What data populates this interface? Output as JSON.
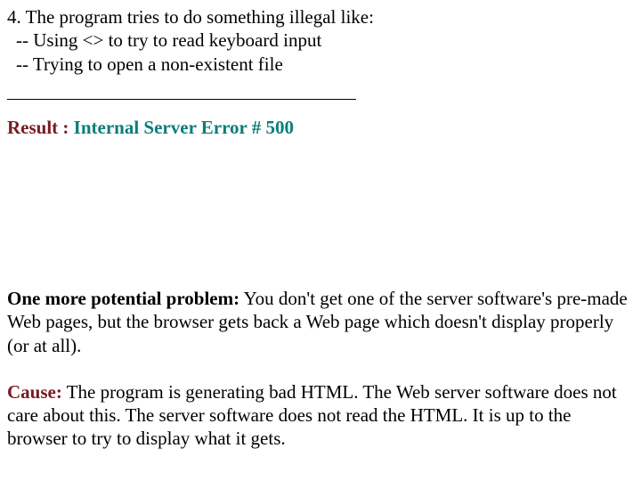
{
  "item4": {
    "lead": "4.  The program tries to do something illegal like:",
    "sub1": " -- Using <> to try to read keyboard input",
    "sub2": " -- Trying to open a non-existent file"
  },
  "result": {
    "label": "Result :",
    "text": " Internal Server Error # 500"
  },
  "problem": {
    "label": "One more potential problem:",
    "text": "  You don't get one of the server software's pre-made Web pages, but the browser gets back a Web page which doesn't display properly (or at all)."
  },
  "cause": {
    "label": "Cause:",
    "text": " The program is generating bad HTML.  The Web server software does not care about this.  The server software does not read the HTML.  It is up to the browser to try to display what it gets."
  }
}
